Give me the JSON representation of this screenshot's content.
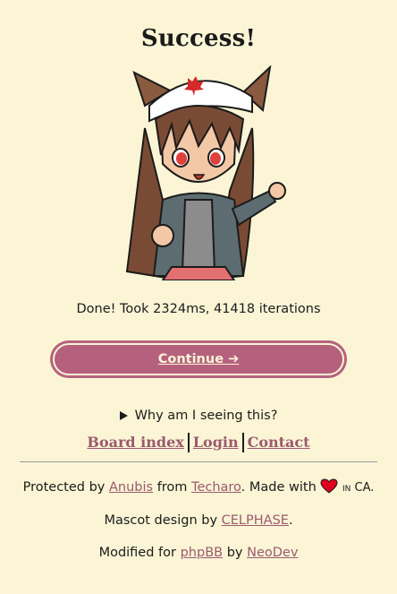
{
  "page": {
    "title": "Success!",
    "status_text": "Done! Took 2324ms, 41418 iterations",
    "continue_label": "Continue ➔",
    "details_label": "Why am I seeing this?"
  },
  "board_links": {
    "board_index": "Board index",
    "login": "Login",
    "contact": "Contact"
  },
  "footer": {
    "protected_by": "Protected by",
    "anubis": "Anubis",
    "from": "from",
    "techaro": "Techaro",
    "made_with": ". Made with",
    "in_ca": "in CA.",
    "mascot_design_by": "Mascot design by",
    "celphase": "CELPHASE",
    "period": ".",
    "modified_for": "Modified for",
    "phpbb": "phpBB",
    "by": "by",
    "neodev": "NeoDev"
  },
  "colors": {
    "background": "#fbf5d6",
    "accent": "#b5617e",
    "link": "#9b5a6f",
    "heart": "#e0001f"
  },
  "icons": {
    "mascot": "anubis-mascot-girl-image",
    "heart": "heart-icon",
    "disclosure": "triangle-right-icon"
  }
}
